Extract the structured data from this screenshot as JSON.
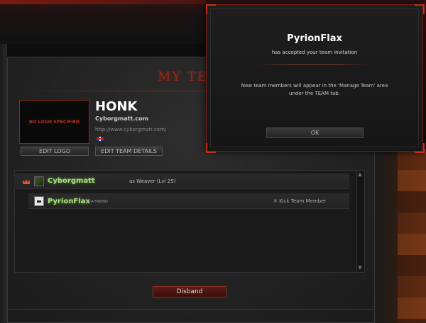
{
  "panel": {
    "title": "MY TEA"
  },
  "team": {
    "logo_placeholder": "NO LOGO SPECIFIED",
    "name": "HONK",
    "tag": "Cyborgmatt.com",
    "url": "http://www.cyborgmatt.com/",
    "flag_icon": "uk-flag-icon",
    "edit_logo_label": "EDIT LOGO",
    "edit_details_label": "EDIT TEAM DETAILS"
  },
  "members": [
    {
      "name": "Cyborgmatt",
      "role_icon": "crown-icon",
      "hero_text": "as Weaver (Lvl 25)"
    },
    {
      "name": "PyrionFlax",
      "friend_label": "IS A FRIEND",
      "kick_label": "Kick Team Member"
    }
  ],
  "actions": {
    "disband_label": "Disband"
  },
  "popup": {
    "title": "PyrionFlax",
    "subtitle": "has accepted your team invitation",
    "message_line1": "New team members will appear in the 'Manage Team' area",
    "message_line2": "under the TEAM tab.",
    "ok_label": "OK"
  },
  "colors": {
    "accent_red": "#9b2618",
    "player_name_green": "#a8e37a",
    "popup_border": "#7a2216"
  }
}
